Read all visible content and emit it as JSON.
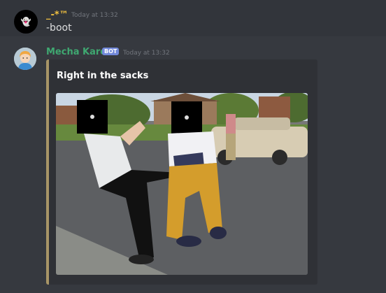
{
  "messages": [
    {
      "username": "_-*™",
      "timestamp": "Today at 13:32",
      "content": "-boot",
      "avatar_glyph": "👻"
    },
    {
      "username": "Mecha Karen",
      "badge": "BOT",
      "timestamp": "Today at 13:32",
      "embed": {
        "title": "Right in the sacks",
        "accent_color": "#a89567"
      }
    }
  ],
  "colors": {
    "background": "#36393f",
    "message_hover": "#32353b",
    "user1_name": "#f0c040",
    "bot_name": "#3fa871",
    "bot_badge": "#7289da",
    "embed_background": "#2f3136"
  },
  "icons": [
    "user-avatar-icon",
    "bot-avatar-icon"
  ]
}
